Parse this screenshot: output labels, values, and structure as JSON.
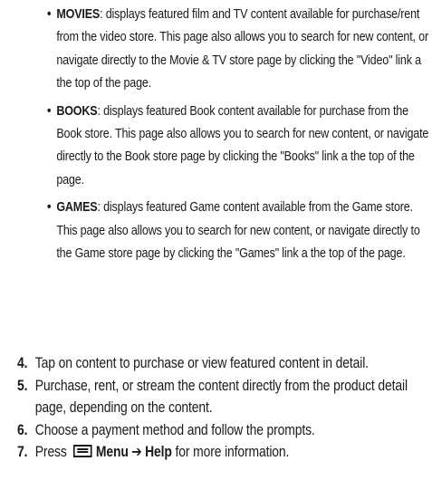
{
  "bullets": [
    {
      "term": "MOVIES",
      "text": ": displays featured film and TV content available for purchase/rent from the video store. This page also allows you to search for new content, or navigate directly to the Movie & TV store page by clicking the \"Video\" link a the top of the page."
    },
    {
      "term": "BOOKS",
      "text": ": displays featured Book content available for purchase from the Book store. This page also allows you to search for new content, or navigate directly to the Book store page by clicking the \"Books\" link a the top of the page."
    },
    {
      "term": "GAMES",
      "text": ": displays featured Game content available from the Game store. This page also allows you to search for new content, or navigate directly to the Game store page by clicking the \"Games\" link a the top of the page."
    }
  ],
  "steps": [
    {
      "number": "4.",
      "text": "Tap on content to purchase or view featured content in detail."
    },
    {
      "number": "5.",
      "text": "Purchase, rent, or stream the content directly from the product detail page, depending on the content."
    },
    {
      "number": "6.",
      "text": "Choose a payment method and follow the prompts."
    },
    {
      "number": "7.",
      "press": "Press",
      "icon": "menu-icon",
      "menu_label": "Menu",
      "arrow": "➔",
      "help_label": "Help",
      "suffix": "for more information."
    }
  ]
}
